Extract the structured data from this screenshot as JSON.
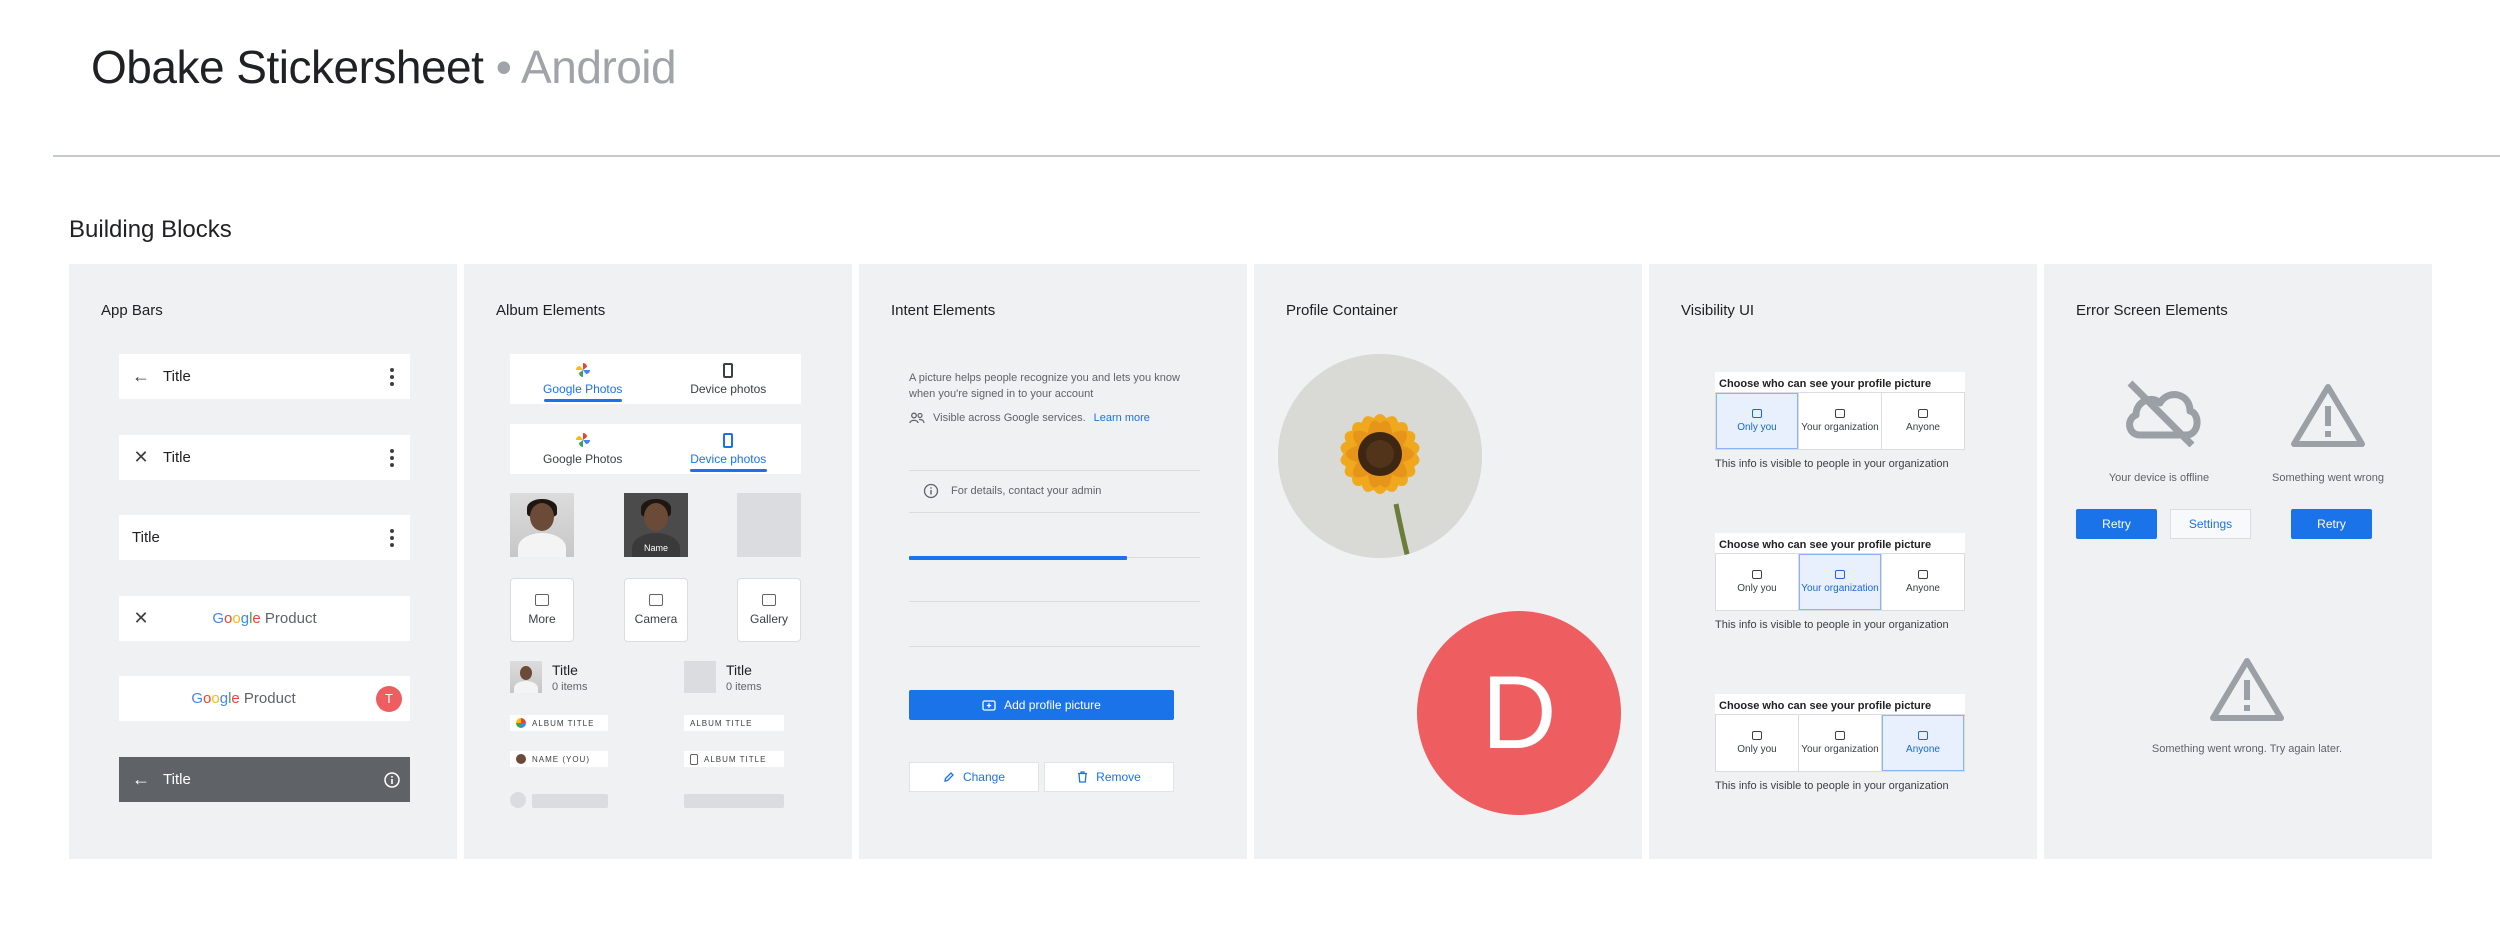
{
  "header": {
    "title": "Obake Stickersheet",
    "subtitle": "• Android"
  },
  "section": {
    "title": "Building Blocks"
  },
  "panels": {
    "app_bars": {
      "title": "App Bars",
      "bars": [
        {
          "leading": "←",
          "title": "Title"
        },
        {
          "leading": "✕",
          "title": "Title"
        },
        {
          "title": "Title"
        },
        {
          "leading": "✕",
          "product": "Product"
        },
        {
          "product": "Product",
          "avatar": "T"
        },
        {
          "leading": "←",
          "title": "Title"
        }
      ],
      "google": [
        "G",
        "o",
        "o",
        "g",
        "l",
        "e"
      ]
    },
    "album": {
      "title": "Album Elements",
      "tab_google": "Google Photos",
      "tab_device": "Device photos",
      "face_name": "Name",
      "more": "More",
      "camera": "Camera",
      "gallery": "Gallery",
      "album1_title": "Title",
      "album1_count": "0 items",
      "album2_title": "Title",
      "album2_count": "0 items",
      "chip_album_title_1": "ALBUM TITLE",
      "chip_album_title_2": "ALBUM TITLE",
      "chip_name_you": "NAME (YOU)",
      "chip_album_title_3": "ALBUM TITLE"
    },
    "intent": {
      "title": "Intent Elements",
      "description": "A picture helps people recognize you and lets you know when you're signed in to your account",
      "visible_text": "Visible across Google services.",
      "learn_more": "Learn more",
      "admin_text": "For details, contact your admin",
      "progress": 0.75,
      "add_button": "Add profile picture",
      "change_button": "Change",
      "remove_button": "Remove"
    },
    "profile": {
      "title": "Profile Container",
      "avatar_letter": "D"
    },
    "visibility": {
      "title": "Visibility UI",
      "heading": "Choose who can see your profile picture",
      "options": [
        "Only you",
        "Your organization",
        "Anyone"
      ],
      "footer": "This info is visible to people in your organization",
      "selected": [
        0,
        1,
        2
      ]
    },
    "error": {
      "title": "Error Screen Elements",
      "offline_caption": "Your device is offline",
      "wrong_caption": "Something went wrong",
      "retry_1": "Retry",
      "settings": "Settings",
      "retry_2": "Retry",
      "try_later": "Something went wrong. Try again later."
    }
  },
  "colors": {
    "accent": "#1a73e8",
    "avatar": "#ee5e61",
    "panel_bg": "#f0f1f3"
  }
}
